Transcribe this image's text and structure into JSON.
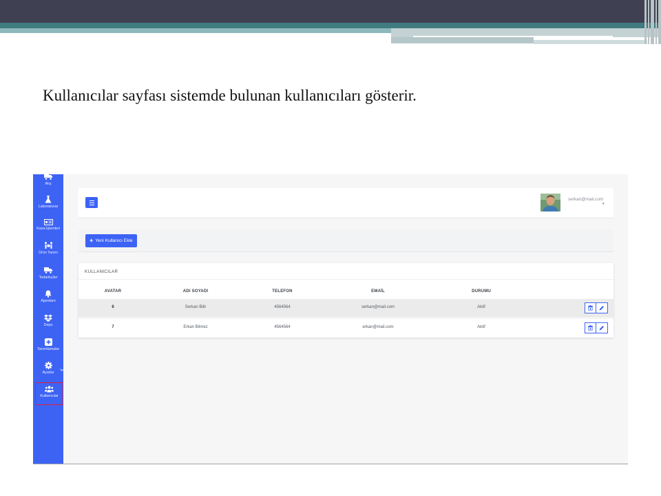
{
  "caption": "Kullanıcılar sayfası sistemde bulunan kullanıcıları gösterir.",
  "sidebar": {
    "items": [
      {
        "label": "Alış",
        "icon": "truck-icon"
      },
      {
        "label": "Laboratuvar",
        "icon": "flask-icon"
      },
      {
        "label": "Kasa İşlemleri",
        "icon": "money-icon"
      },
      {
        "label": "Ürün Tanım",
        "icon": "people-carry-icon"
      },
      {
        "label": "Tedarikçiler",
        "icon": "truck-icon"
      },
      {
        "label": "Ajandam",
        "icon": "bell-icon"
      },
      {
        "label": "Depo",
        "icon": "dropbox-icon"
      },
      {
        "label": "Tanımlamalar",
        "icon": "plus-square-icon"
      },
      {
        "label": "Ayarlar",
        "icon": "gear-icon"
      },
      {
        "label": "Kullanıcılar",
        "icon": "users-icon"
      }
    ],
    "active": "Kullanıcılar",
    "accent": "#3d63f5"
  },
  "header": {
    "user_email": "serkan@mail.com"
  },
  "actions": {
    "add_user_label": "Yeni Kullanıcı Ekle"
  },
  "users_table": {
    "title": "KULLANICILAR",
    "columns": [
      "AVATAR",
      "ADI SOYADI",
      "TELEFON",
      "EMAİL",
      "DURUMU"
    ],
    "rows": [
      {
        "avatar": "6",
        "name": "Serkan Bilir",
        "phone": "4564564",
        "email": "serkan@mail.com",
        "status": "Aktif"
      },
      {
        "avatar": "7",
        "name": "Erkan Bilmez",
        "phone": "4564564",
        "email": "erkan@mail.com",
        "status": "Aktif"
      }
    ],
    "row_actions": [
      "trash-icon",
      "pencil-icon"
    ]
  }
}
